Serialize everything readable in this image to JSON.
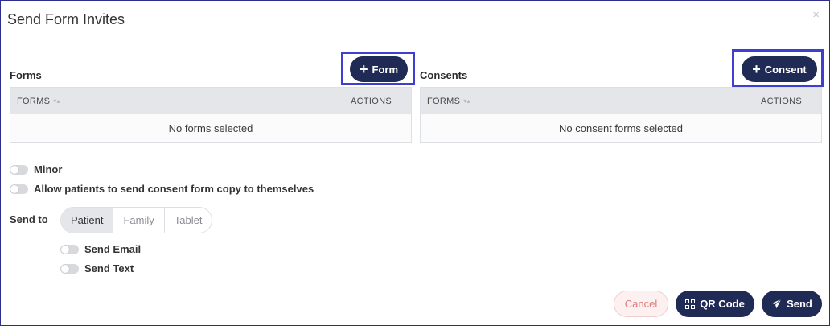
{
  "modal": {
    "title": "Send Form Invites",
    "close": "×"
  },
  "forms": {
    "title": "Forms",
    "add_label": "Form",
    "table": {
      "col_name": "FORMS",
      "col_actions": "ACTIONS",
      "empty": "No forms selected"
    }
  },
  "consents": {
    "title": "Consents",
    "add_label": "Consent",
    "table": {
      "col_name": "FORMS",
      "col_actions": "ACTIONS",
      "empty": "No consent forms selected"
    }
  },
  "options": {
    "minor": "Minor",
    "allow_copy": "Allow patients to send consent form copy to themselves"
  },
  "send_to": {
    "label": "Send to",
    "tabs": [
      "Patient",
      "Family",
      "Tablet"
    ],
    "selected": "Patient",
    "send_email": "Send Email",
    "send_text": "Send Text"
  },
  "footer": {
    "cancel": "Cancel",
    "qr_code": "QR Code",
    "send": "Send"
  },
  "colors": {
    "primary": "#1f2a55",
    "highlight": "#3c3fd1",
    "cancel_text": "#e07a7a",
    "border": "#2e2f8a"
  }
}
